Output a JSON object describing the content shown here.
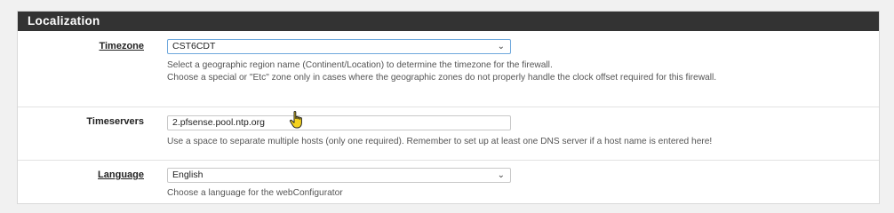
{
  "section": {
    "title": "Localization"
  },
  "timezone": {
    "label": "Timezone",
    "value": "CST6CDT",
    "help_line1": "Select a geographic region name (Continent/Location) to determine the timezone for the firewall.",
    "help_line2": "Choose a special or \"Etc\" zone only in cases where the geographic zones do not properly handle the clock offset required for this firewall."
  },
  "timeservers": {
    "label": "Timeservers",
    "value": "2.pfsense.pool.ntp.org",
    "help": "Use a space to separate multiple hosts (only one required). Remember to set up at least one DNS server if a host name is entered here!"
  },
  "language": {
    "label": "Language",
    "value": "English",
    "help": "Choose a language for the webConfigurator"
  },
  "icons": {
    "dropdown": "chevron-down-icon",
    "cursor": "hand-pointer-icon"
  },
  "colors": {
    "heading_bg": "#333333",
    "focus_border": "#6fa8dc",
    "cursor_fill": "#f4d21f"
  }
}
